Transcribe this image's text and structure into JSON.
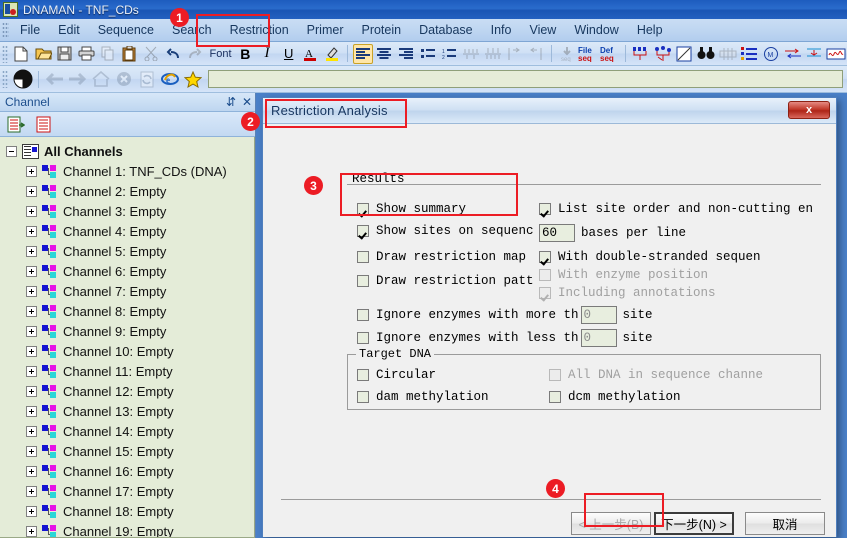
{
  "window": {
    "title": "DNAMAN - TNF_CDs",
    "app_icon": "dnaman-logo-icon"
  },
  "menubar": {
    "items": [
      {
        "label": "File",
        "name": "menu-file"
      },
      {
        "label": "Edit",
        "name": "menu-edit"
      },
      {
        "label": "Sequence",
        "name": "menu-sequence"
      },
      {
        "label": "Search",
        "name": "menu-search"
      },
      {
        "label": "Restriction",
        "name": "menu-restriction"
      },
      {
        "label": "Primer",
        "name": "menu-primer"
      },
      {
        "label": "Protein",
        "name": "menu-protein"
      },
      {
        "label": "Database",
        "name": "menu-database"
      },
      {
        "label": "Info",
        "name": "menu-info"
      },
      {
        "label": "View",
        "name": "menu-view"
      },
      {
        "label": "Window",
        "name": "menu-window"
      },
      {
        "label": "Help",
        "name": "menu-help"
      }
    ]
  },
  "toolbar_main": {
    "font_label": "Font",
    "bold_label": "B",
    "icons": [
      "new-document-icon",
      "open-folder-icon",
      "save-disk-icon",
      "print-icon",
      "copy-icon",
      "paste-icon",
      "cut-scissors-icon",
      "undo-arrow-icon",
      "redo-arrow-icon"
    ],
    "format_icons": [
      "underline-icon",
      "font-color-icon",
      "highlighter-icon",
      "align-left-icon",
      "align-center-icon",
      "align-right-icon",
      "bullet-list-icon",
      "numbered-list-icon",
      "align-seq-icon",
      "consensus-icon",
      "shift-left-icon",
      "shift-right-icon",
      "translate-seq-icon",
      "file-seq-icon",
      "def-seq-icon",
      "multi-align-icon",
      "phylo-tree-icon",
      "dot-plot-icon",
      "find-binoculars-icon",
      "restriction-map-icon",
      "site-list-icon",
      "methylation-icon",
      "primer-design-icon",
      "pcr-icon",
      "plasmid-icon"
    ]
  },
  "toolbar_browser": {
    "icons": [
      "dnaman-globe-icon",
      "back-arrow-icon",
      "forward-arrow-icon",
      "home-icon",
      "stop-icon",
      "refresh-icon",
      "internet-explorer-icon",
      "favorites-star-icon"
    ],
    "address_value": ""
  },
  "channel_panel": {
    "title": "Channel",
    "pin_icon": "pin-icon",
    "close_icon": "close-icon",
    "toolbar_icons": [
      "load-sequence-icon",
      "new-sequence-icon"
    ],
    "root_label": "All Channels",
    "items": [
      {
        "label": "Channel 1: TNF_CDs (DNA)"
      },
      {
        "label": "Channel 2: Empty"
      },
      {
        "label": "Channel 3: Empty"
      },
      {
        "label": "Channel 4: Empty"
      },
      {
        "label": "Channel 5: Empty"
      },
      {
        "label": "Channel 6: Empty"
      },
      {
        "label": "Channel 7: Empty"
      },
      {
        "label": "Channel 8: Empty"
      },
      {
        "label": "Channel 9: Empty"
      },
      {
        "label": "Channel 10: Empty"
      },
      {
        "label": "Channel 11: Empty"
      },
      {
        "label": "Channel 12: Empty"
      },
      {
        "label": "Channel 13: Empty"
      },
      {
        "label": "Channel 14: Empty"
      },
      {
        "label": "Channel 15: Empty"
      },
      {
        "label": "Channel 16: Empty"
      },
      {
        "label": "Channel 17: Empty"
      },
      {
        "label": "Channel 18: Empty"
      },
      {
        "label": "Channel 19: Empty"
      }
    ]
  },
  "dialog": {
    "title": "Restriction Analysis",
    "close_label": "x",
    "results_group_label": "Results",
    "left_options": [
      {
        "label": "Show summary",
        "checked": true,
        "disabled": false,
        "name": "checkbox-show-summary"
      },
      {
        "label": "Show sites on sequenc",
        "checked": true,
        "disabled": false,
        "name": "checkbox-show-sites-on-sequence"
      },
      {
        "label": "Draw restriction map",
        "checked": false,
        "disabled": false,
        "name": "checkbox-draw-restriction-map"
      },
      {
        "label": "Draw restriction patt",
        "checked": false,
        "disabled": false,
        "name": "checkbox-draw-restriction-pattern"
      }
    ],
    "right_options": [
      {
        "label": "List site order and non-cutting en",
        "checked": true,
        "disabled": false,
        "name": "checkbox-list-site-order"
      },
      {
        "label": "With double-stranded sequen",
        "checked": true,
        "disabled": false,
        "name": "checkbox-with-double-stranded-sequence"
      },
      {
        "label": "With enzyme position",
        "checked": false,
        "disabled": true,
        "name": "checkbox-with-enzyme-position"
      },
      {
        "label": "Including annotations",
        "checked": true,
        "disabled": true,
        "name": "checkbox-including-annotations"
      }
    ],
    "bases_per_line": {
      "value": "60",
      "suffix": "bases per line"
    },
    "ignore_more": {
      "label": "Ignore enzymes with more th",
      "value": "0",
      "suffix": "site",
      "checked": false
    },
    "ignore_less": {
      "label": "Ignore enzymes with less th",
      "value": "0",
      "suffix": "site",
      "checked": false
    },
    "target_group_label": "Target DNA",
    "target_options": [
      {
        "label": "Circular",
        "checked": false,
        "disabled": false,
        "name": "checkbox-circular"
      },
      {
        "label": "All DNA in sequence channe",
        "checked": false,
        "disabled": true,
        "name": "checkbox-all-dna-in-sequence-channel"
      },
      {
        "label": "dam methylation",
        "checked": false,
        "disabled": false,
        "name": "checkbox-dam-methylation"
      },
      {
        "label": "dcm methylation",
        "checked": false,
        "disabled": false,
        "name": "checkbox-dcm-methylation"
      }
    ],
    "buttons": {
      "back": "< 上一步(B)",
      "next": "下一步(N) >",
      "cancel": "取消"
    }
  },
  "annotations": {
    "badges": [
      {
        "number": "1",
        "name": "annotation-badge-1"
      },
      {
        "number": "2",
        "name": "annotation-badge-2"
      },
      {
        "number": "3",
        "name": "annotation-badge-3"
      },
      {
        "number": "4",
        "name": "annotation-badge-4"
      }
    ],
    "highlight_color": "#ec1c24"
  }
}
